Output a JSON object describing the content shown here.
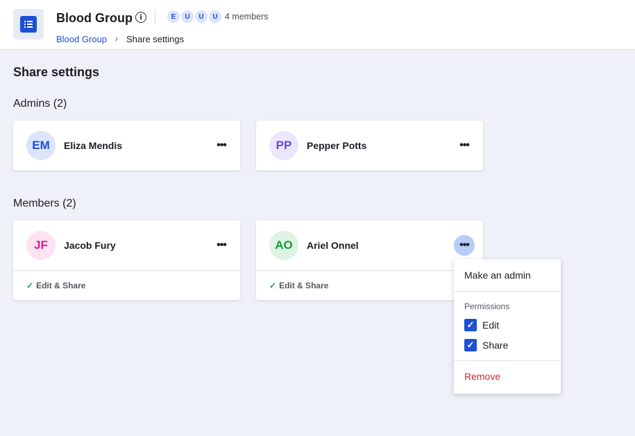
{
  "header": {
    "title": "Blood Group",
    "logo_icon": "list-icon",
    "info_icon": "info-icon",
    "member_avatars": [
      "E",
      "U",
      "U",
      "U"
    ],
    "members_count": "4 members",
    "breadcrumb": {
      "link": "Blood Group",
      "separator": "›",
      "current": "Share settings"
    }
  },
  "page": {
    "title": "Share settings",
    "admins_label": "Admins (2)",
    "members_label": "Members (2)"
  },
  "admins": [
    {
      "initials": "EM",
      "name": "Eliza Mendis",
      "avatar_bg": "#dbe4fb",
      "avatar_fg": "#1d4fd7",
      "more": "•••"
    },
    {
      "initials": "PP",
      "name": "Pepper Potts",
      "avatar_bg": "#ebe7fb",
      "avatar_fg": "#6b46d6",
      "more": "•••"
    }
  ],
  "members": [
    {
      "initials": "JF",
      "name": "Jacob Fury",
      "avatar_bg": "#fde2f2",
      "avatar_fg": "#d41f8f",
      "more": "•••",
      "permission": "Edit & Share"
    },
    {
      "initials": "AO",
      "name": "Ariel Onnel",
      "avatar_bg": "#ddf3e3",
      "avatar_fg": "#1b9a3c",
      "more": "•••",
      "permission": "Edit & Share"
    }
  ],
  "menu": {
    "make_admin": "Make an admin",
    "permissions_label": "Permissions",
    "options": [
      {
        "label": "Edit",
        "checked": true
      },
      {
        "label": "Share",
        "checked": true
      }
    ],
    "remove": "Remove"
  },
  "colors": {
    "accent": "#1d4fd7",
    "danger": "#e02424",
    "success": "#1b9a3c",
    "background": "#eff1f8"
  }
}
